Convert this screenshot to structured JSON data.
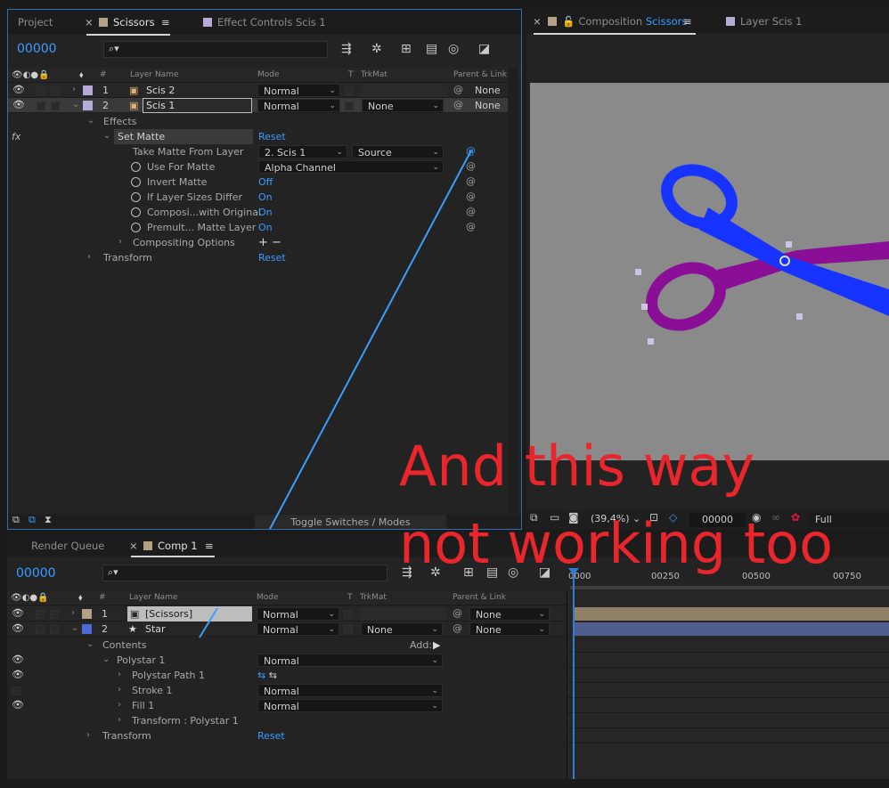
{
  "top_tabs": {
    "project": "Project",
    "comp_scissors": "Scissors",
    "effect_controls": "Effect Controls Scis 1",
    "composition_prefix": "Composition",
    "composition_name": "Scissors",
    "layer_viewer": "Layer Scis 1"
  },
  "timeline1": {
    "timecode": "00000",
    "search_placeholder": "",
    "headers": {
      "num": "#",
      "layer_name": "Layer Name",
      "mode": "Mode",
      "t": "T",
      "trkmat": "TrkMat",
      "parent": "Parent & Link"
    },
    "layers": [
      {
        "num": "1",
        "name": "Scis 2",
        "mode": "Normal",
        "trkmat": "",
        "parent": "None"
      },
      {
        "num": "2",
        "name": "Scis 1",
        "mode": "Normal",
        "trkmat": "None",
        "parent": "None"
      }
    ],
    "effects_label": "Effects",
    "fx_label": "fx",
    "set_matte": {
      "name": "Set Matte",
      "reset": "Reset"
    },
    "props": [
      {
        "name": "Take Matte From Layer",
        "value": "2. Scis 1",
        "value2": "Source"
      },
      {
        "name": "Use For Matte",
        "value": "Alpha Channel"
      },
      {
        "name": "Invert Matte",
        "value": "Off"
      },
      {
        "name": "If Layer Sizes Differ",
        "value": "On"
      },
      {
        "name": "Composi...with Original",
        "value": "On"
      },
      {
        "name": "Premult... Matte Layer",
        "value": "On"
      }
    ],
    "compositing_options": "Compositing Options",
    "plus_minus": "+ −",
    "transform": {
      "name": "Transform",
      "reset": "Reset"
    },
    "toggle": "Toggle Switches / Modes"
  },
  "viewer": {
    "zoom": "(39,4%)",
    "timecode": "00000",
    "resolution": "Full"
  },
  "bottom_tabs": {
    "render_queue": "Render Queue",
    "comp1": "Comp 1"
  },
  "timeline2": {
    "timecode": "00000",
    "search_placeholder": "",
    "headers": {
      "num": "#",
      "layer_name": "Layer Name",
      "mode": "Mode",
      "t": "T",
      "trkmat": "TrkMat",
      "parent": "Parent & Link"
    },
    "layers": [
      {
        "num": "1",
        "name": "[Scissors]",
        "mode": "Normal",
        "trkmat": "",
        "parent": "None"
      },
      {
        "num": "2",
        "name": "Star",
        "mode": "Normal",
        "trkmat": "None",
        "parent": "None"
      }
    ],
    "contents_label": "Contents",
    "add_label": "Add:",
    "shape_items": [
      {
        "name": "Polystar 1",
        "value": "Normal"
      },
      {
        "name": "Polystar Path 1",
        "value": ""
      },
      {
        "name": "Stroke 1",
        "value": "Normal"
      },
      {
        "name": "Fill 1",
        "value": "Normal"
      },
      {
        "name": "Transform : Polystar 1",
        "value": ""
      }
    ],
    "transform": {
      "name": "Transform",
      "reset": "Reset"
    },
    "ruler": [
      "0000",
      "00250",
      "00500",
      "00750"
    ]
  },
  "annotation": {
    "line1": "And this way",
    "line2": "not working too"
  },
  "colors": {
    "accent_blue": "#3a9dff",
    "annotation_red": "#e8262c",
    "scissors_blue": "#1733ff",
    "scissors_purple": "#8a0f96",
    "label_tan": "#b3a186",
    "label_lavender": "#b7a9d9"
  }
}
